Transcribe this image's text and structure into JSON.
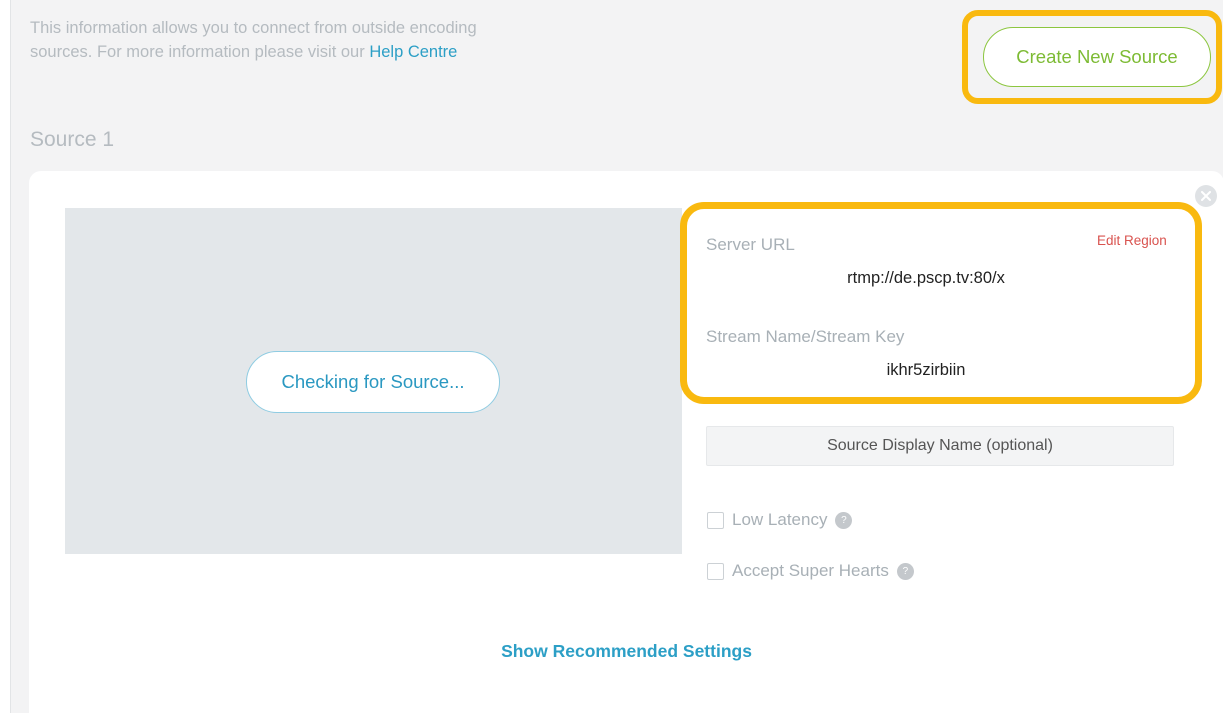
{
  "intro": {
    "text": "This information allows you to connect from outside encoding sources. For more information please visit our ",
    "link_label": "Help Centre"
  },
  "header": {
    "create_label": "Create New Source"
  },
  "section": {
    "title": "Source 1"
  },
  "preview": {
    "checking_label": "Checking for Source..."
  },
  "server": {
    "url_label": "Server URL",
    "edit_region_label": "Edit Region",
    "url_value": "rtmp://de.pscp.tv:80/x",
    "key_label": "Stream Name/Stream Key",
    "key_value": "ikhr5zirbiin"
  },
  "form": {
    "display_name_placeholder": "Source Display Name (optional)",
    "low_latency_label": "Low Latency",
    "super_hearts_label": "Accept Super Hearts",
    "help_glyph": "?"
  },
  "footer": {
    "show_settings_label": "Show Recommended Settings"
  },
  "icons": {
    "close": "close-icon",
    "help": "help-icon"
  },
  "colors": {
    "highlight": "#f9b90f",
    "accent_blue": "#2c9fc6",
    "accent_green": "#8cc63f",
    "edit_red": "#d9534f"
  }
}
